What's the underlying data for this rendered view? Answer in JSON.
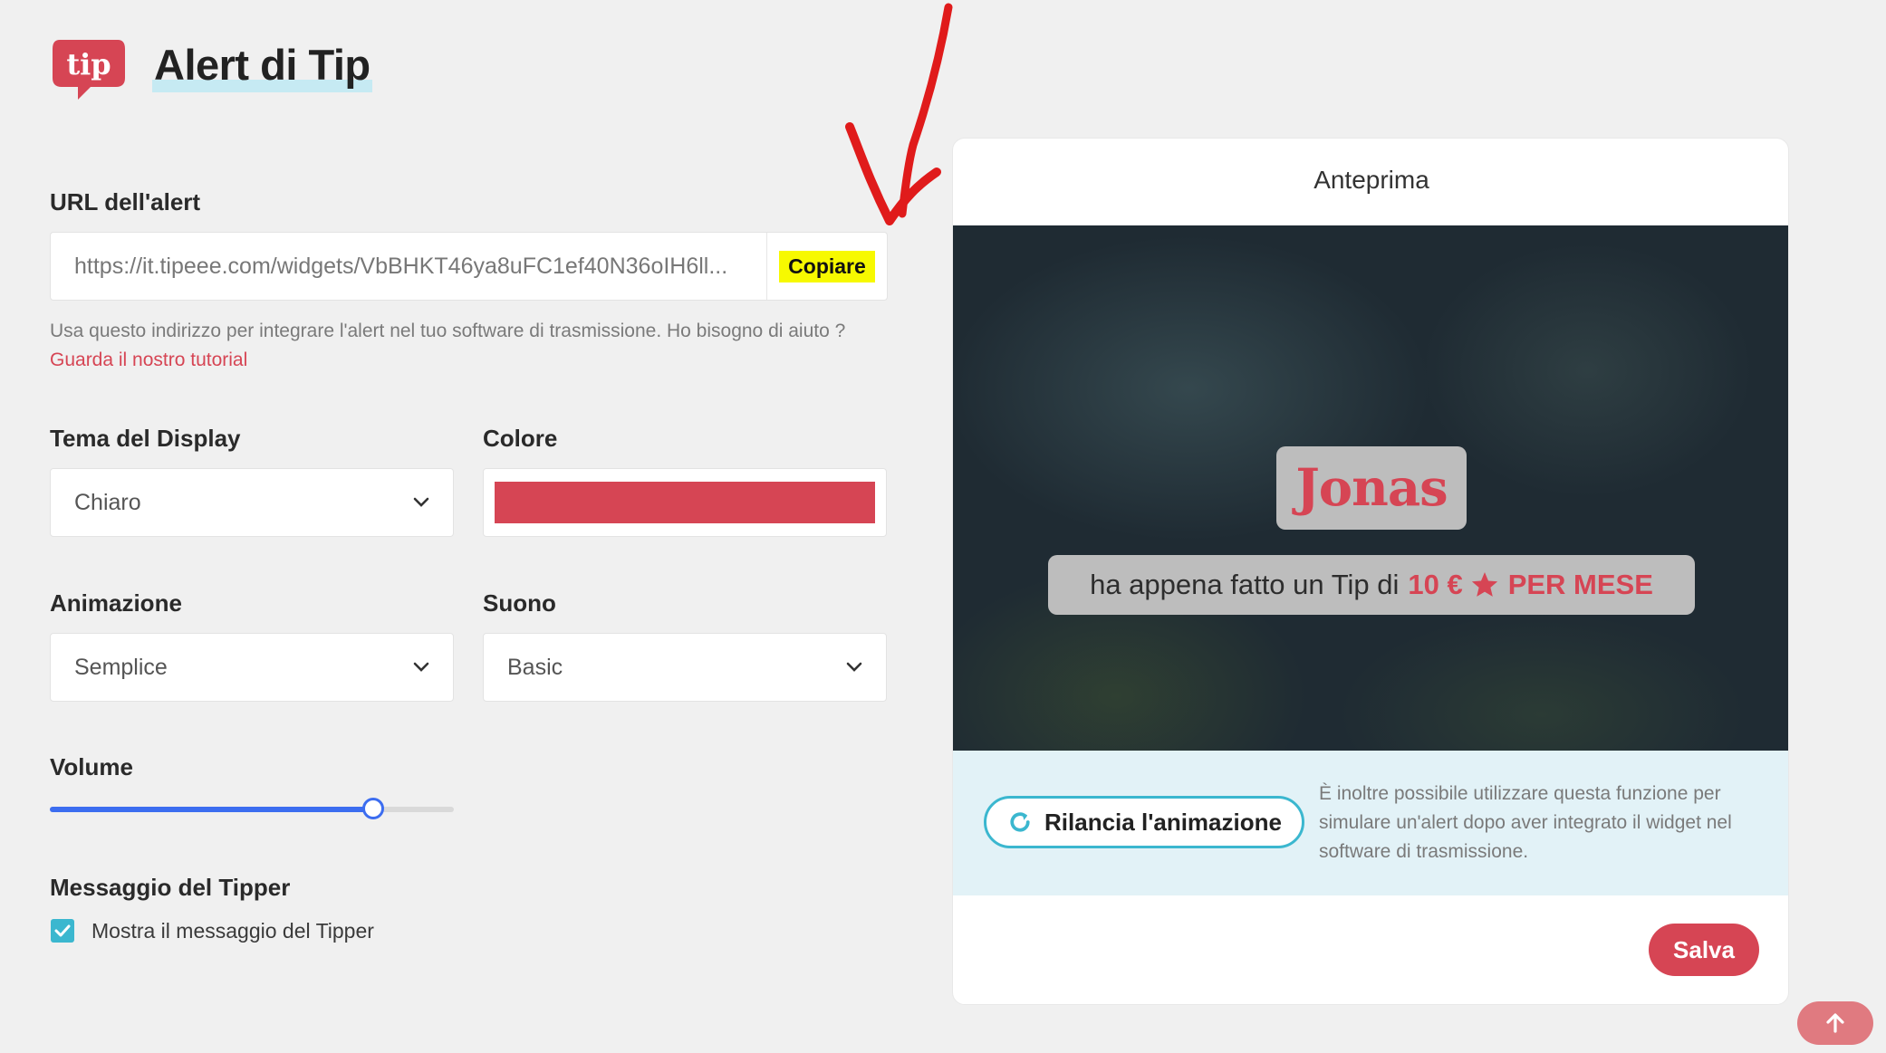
{
  "header": {
    "logo_text": "tip",
    "title": "Alert di Tip"
  },
  "url_section": {
    "label": "URL dell'alert",
    "value": "https://it.tipeee.com/widgets/VbBHKT46ya8uFC1ef40N36oIH6ll...",
    "copy_label": "Copiare",
    "help_text": "Usa questo indirizzo per integrare l'alert nel tuo software di trasmissione. Ho bisogno di aiuto ? ",
    "help_link": "Guarda il nostro tutorial"
  },
  "theme": {
    "label": "Tema del Display",
    "selected": "Chiaro"
  },
  "color": {
    "label": "Colore",
    "value": "#d64554"
  },
  "animation": {
    "label": "Animazione",
    "selected": "Semplice"
  },
  "sound": {
    "label": "Suono",
    "selected": "Basic"
  },
  "volume": {
    "label": "Volume",
    "value": 0.8
  },
  "tipper_message": {
    "label": "Messaggio del Tipper",
    "checkbox_label": "Mostra il messaggio del Tipper",
    "checked": true
  },
  "preview": {
    "title": "Anteprima",
    "name": "Jonas",
    "message_prefix": "ha appena fatto un Tip di",
    "amount": "10 €",
    "period": "PER MESE",
    "replay_label": "Rilancia l'animazione",
    "replay_note": "È inoltre possibile utilizzare questa funzione per simulare un'alert dopo aver integrato il widget nel software di trasmissione.",
    "save_label": "Salva"
  },
  "colors": {
    "accent": "#d64554",
    "teal": "#3bb7cf",
    "slider": "#3c6df0",
    "highlight": "#f7f900"
  },
  "icons": {
    "logo": "tip-logo-icon",
    "chevron": "chevron-down-icon",
    "check": "check-icon",
    "star": "star-icon",
    "refresh": "refresh-icon",
    "arrow_up": "arrow-up-icon",
    "annotation": "red-arrow-annotation-icon"
  }
}
